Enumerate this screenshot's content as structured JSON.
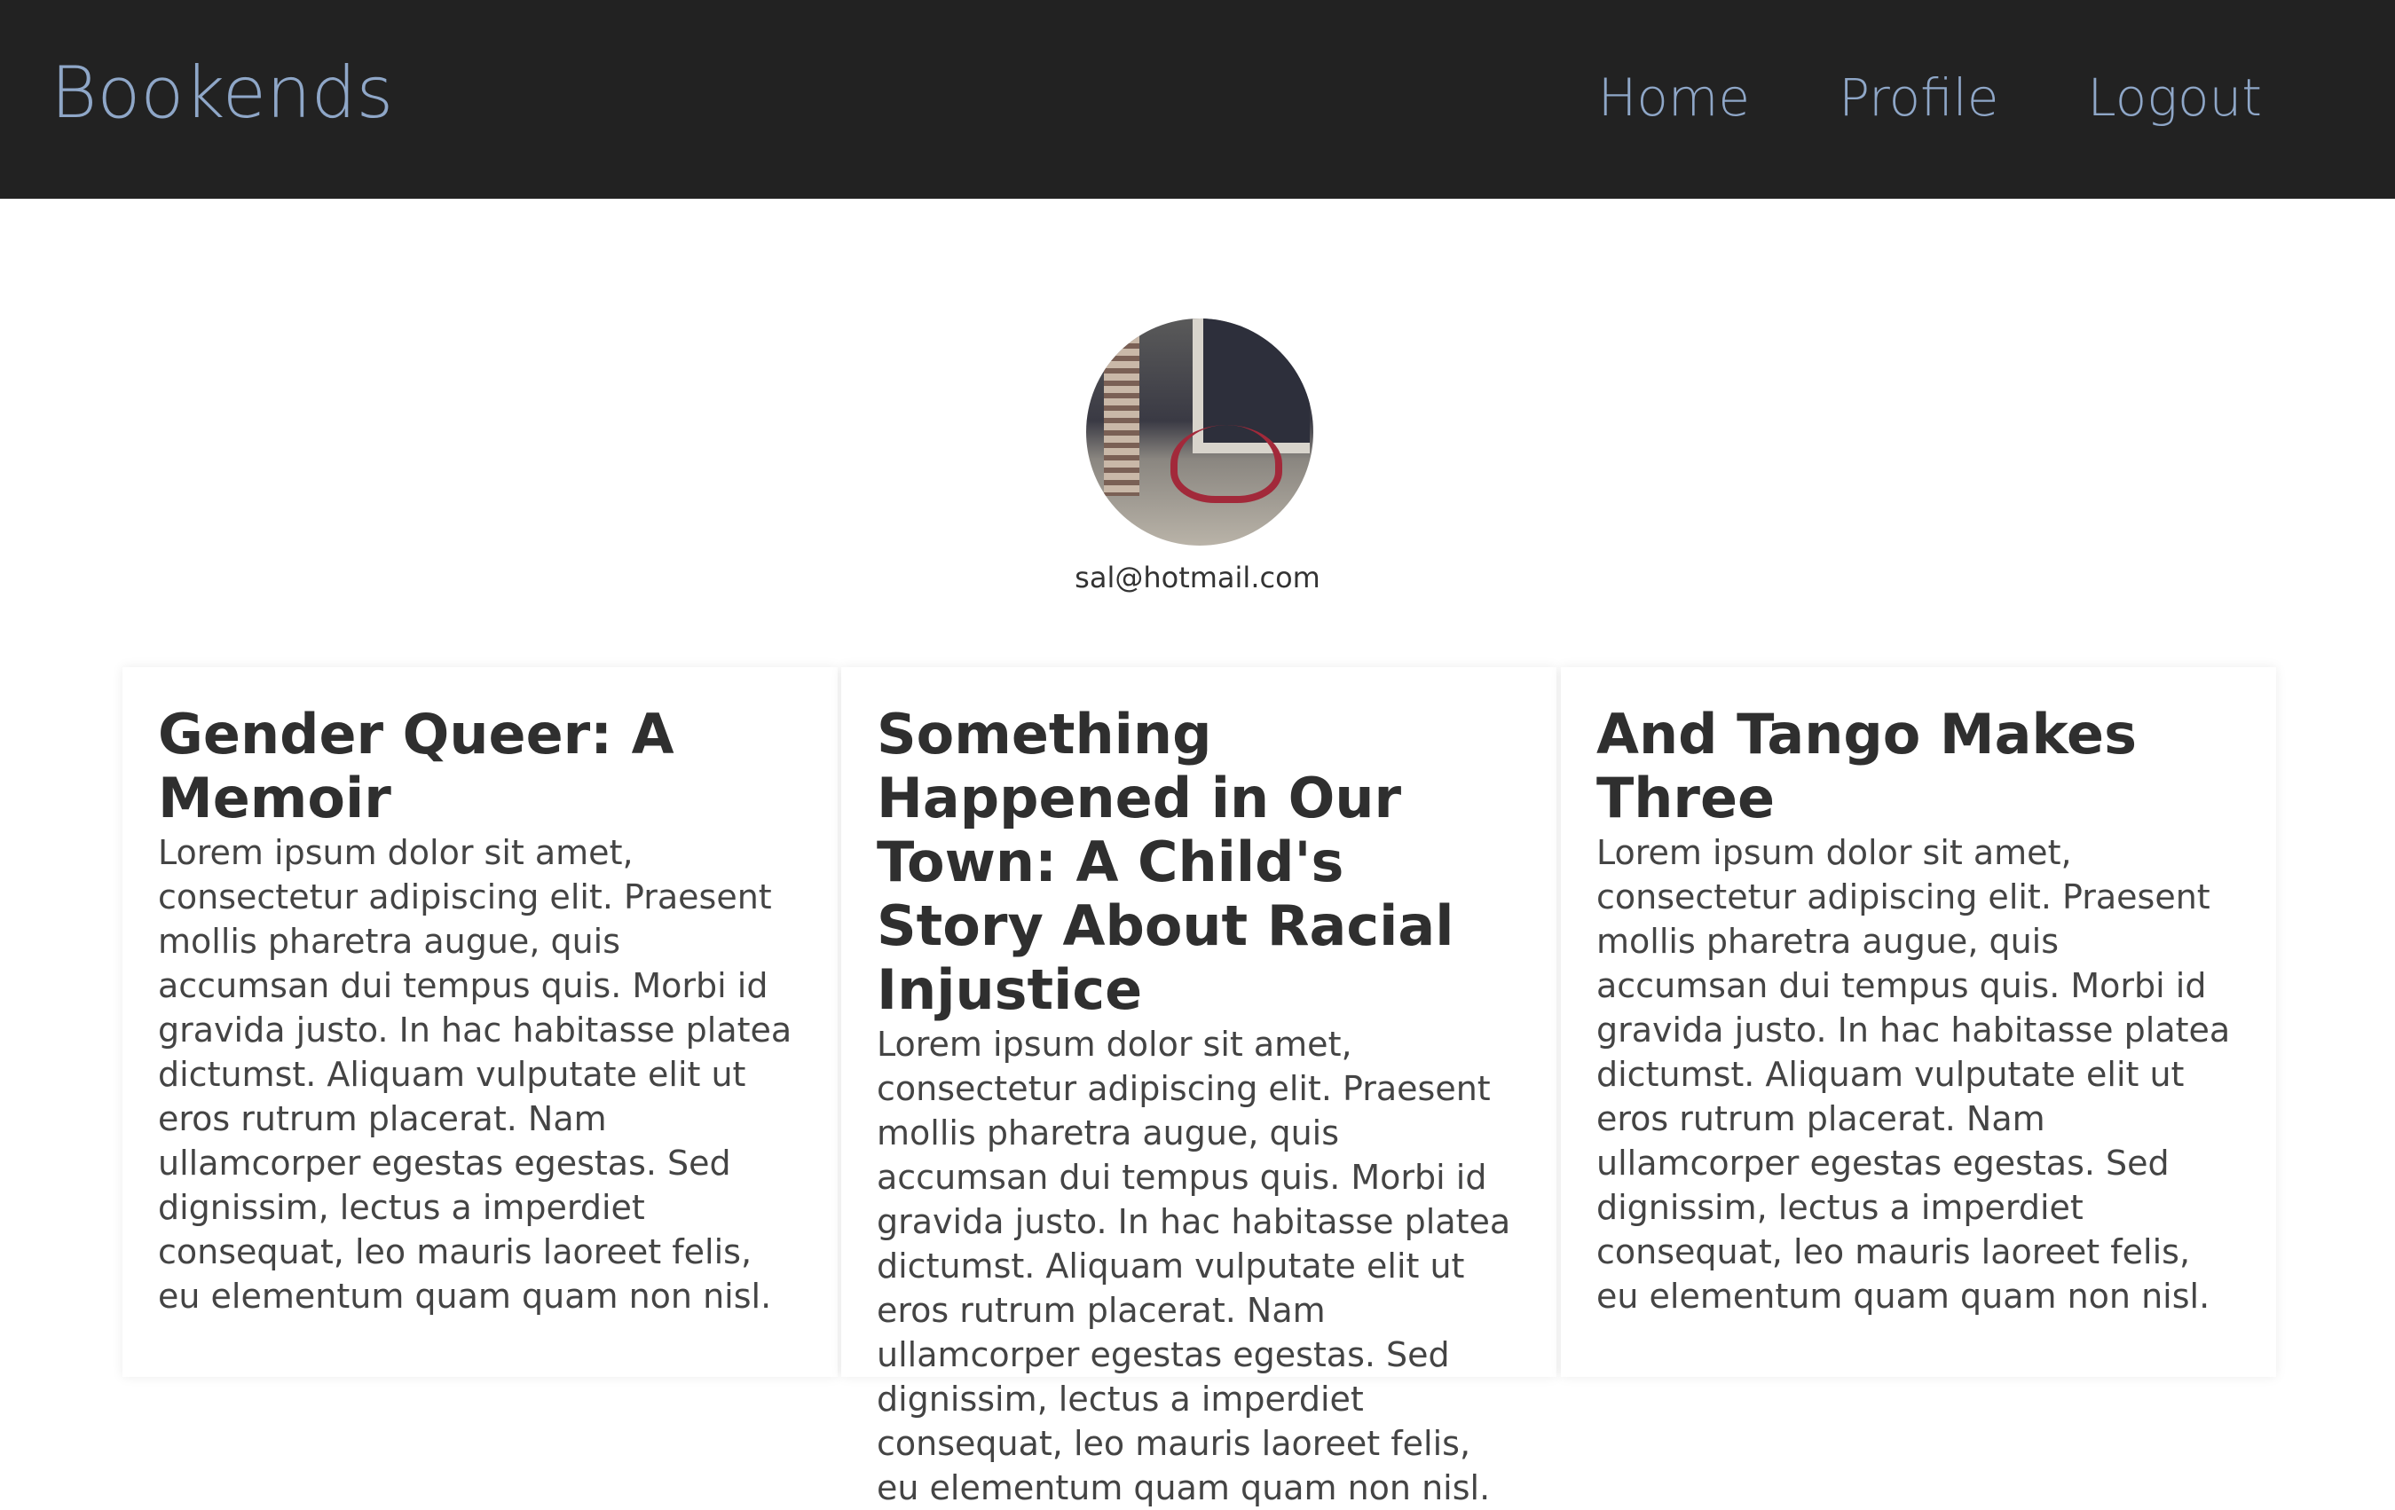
{
  "header": {
    "brand": "Bookends",
    "nav": [
      "Home",
      "Profile",
      "Logout"
    ]
  },
  "profile": {
    "email": "sal@hotmail.com",
    "avatar": "tricycle-photo"
  },
  "books": [
    {
      "title": "Gender Queer: A Memoir",
      "description": "Lorem ipsum dolor sit amet, consectetur adipiscing elit. Praesent mollis pharetra augue, quis accumsan dui tempus quis. Morbi id gravida justo. In hac habitasse platea dictumst. Aliquam vulputate elit ut eros rutrum placerat. Nam ullamcorper egestas egestas. Sed dignissim, lectus a imperdiet consequat, leo mauris laoreet felis, eu elementum quam quam non nisl."
    },
    {
      "title": "Something Happened in Our Town: A Child's Story About Racial Injustice",
      "description": "Lorem ipsum dolor sit amet, consectetur adipiscing elit. Praesent mollis pharetra augue, quis accumsan dui tempus quis. Morbi id gravida justo. In hac habitasse platea dictumst. Aliquam vulputate elit ut eros rutrum placerat. Nam ullamcorper egestas egestas. Sed dignissim, lectus a imperdiet consequat, leo mauris laoreet felis, eu elementum quam quam non nisl."
    },
    {
      "title": "And Tango Makes Three",
      "description": "Lorem ipsum dolor sit amet, consectetur adipiscing elit. Praesent mollis pharetra augue, quis accumsan dui tempus quis. Morbi id gravida justo. In hac habitasse platea dictumst. Aliquam vulputate elit ut eros rutrum placerat. Nam ullamcorper egestas egestas. Sed dignissim, lectus a imperdiet consequat, leo mauris laoreet felis, eu elementum quam quam non nisl."
    }
  ]
}
